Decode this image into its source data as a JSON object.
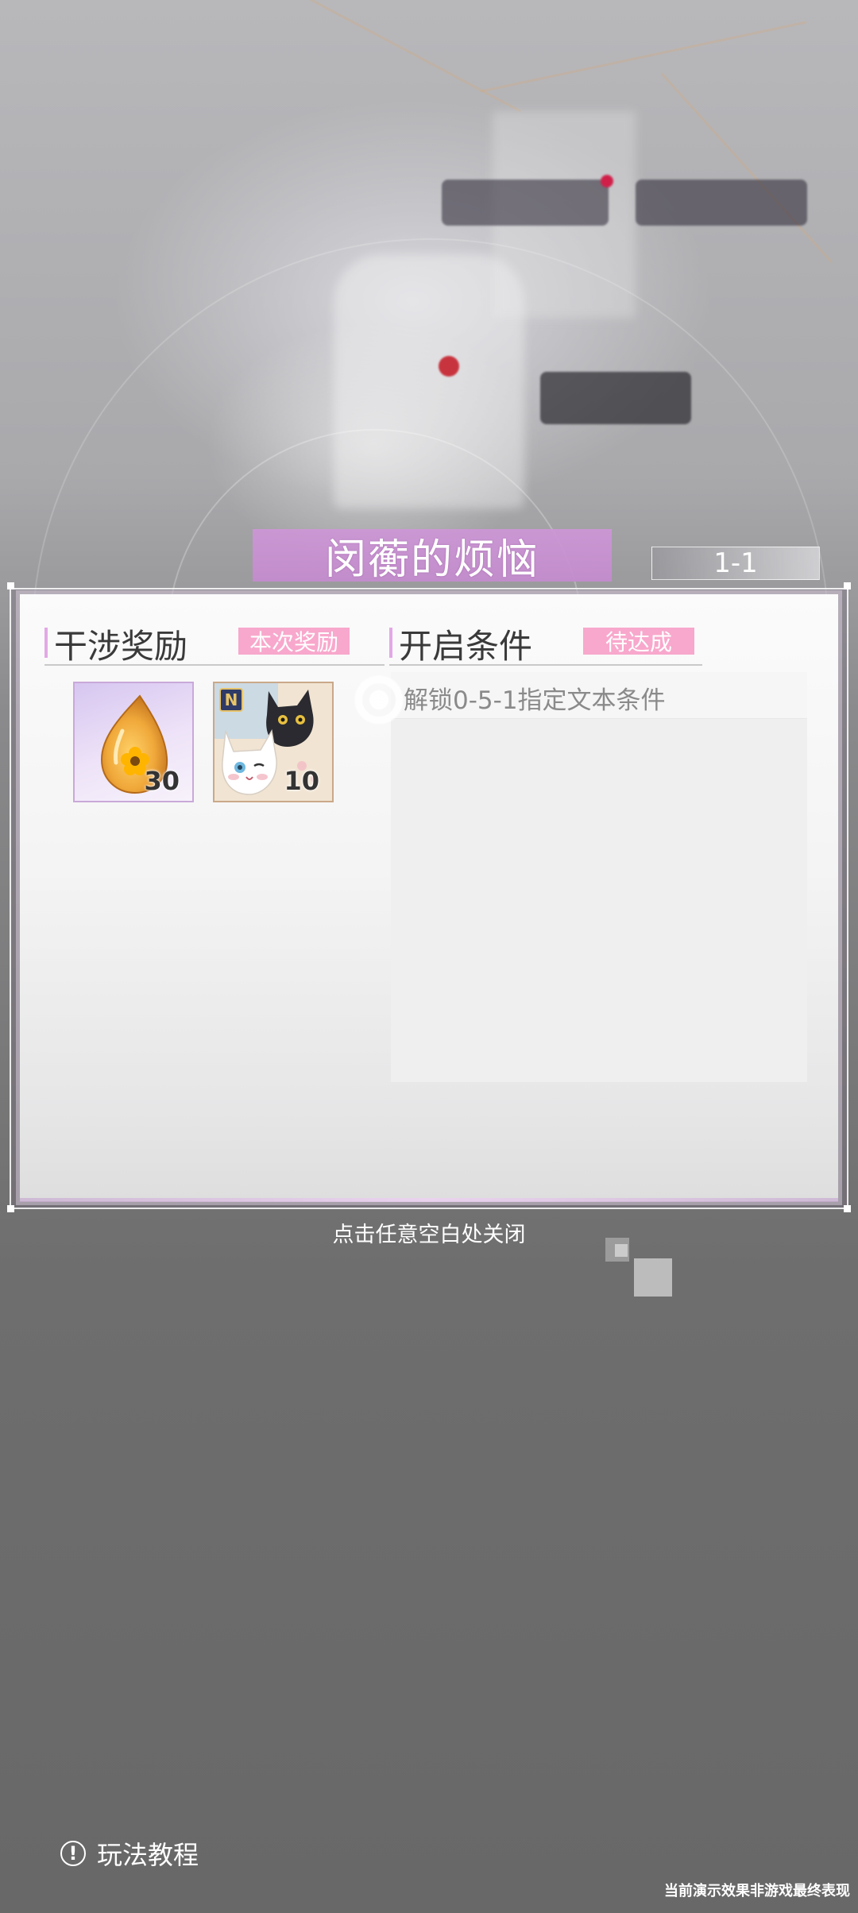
{
  "dialog": {
    "title": "闵蘅的烦恼",
    "stage_number": "1-1",
    "rewards": {
      "label": "干涉奖励",
      "tag": "本次奖励",
      "items": [
        {
          "icon": "amber-gem-icon",
          "quantity": "30"
        },
        {
          "icon": "cat-card-icon",
          "badge": "N",
          "quantity": "10"
        }
      ]
    },
    "conditions": {
      "label": "开启条件",
      "tag": "待达成",
      "items": [
        "解锁0-5-1指定文本条件"
      ]
    },
    "close_hint": "点击任意空白处关闭"
  },
  "footer": {
    "tutorial_label": "玩法教程",
    "tutorial_icon": "exclamation-circle-icon",
    "disclaimer": "当前演示效果非游戏最终表现"
  },
  "colors": {
    "title_banner": "#c78fd4",
    "tag_pink": "#f8a8cc",
    "section_accent": "#e2a8e6",
    "card_border": "#c9a9d9"
  }
}
